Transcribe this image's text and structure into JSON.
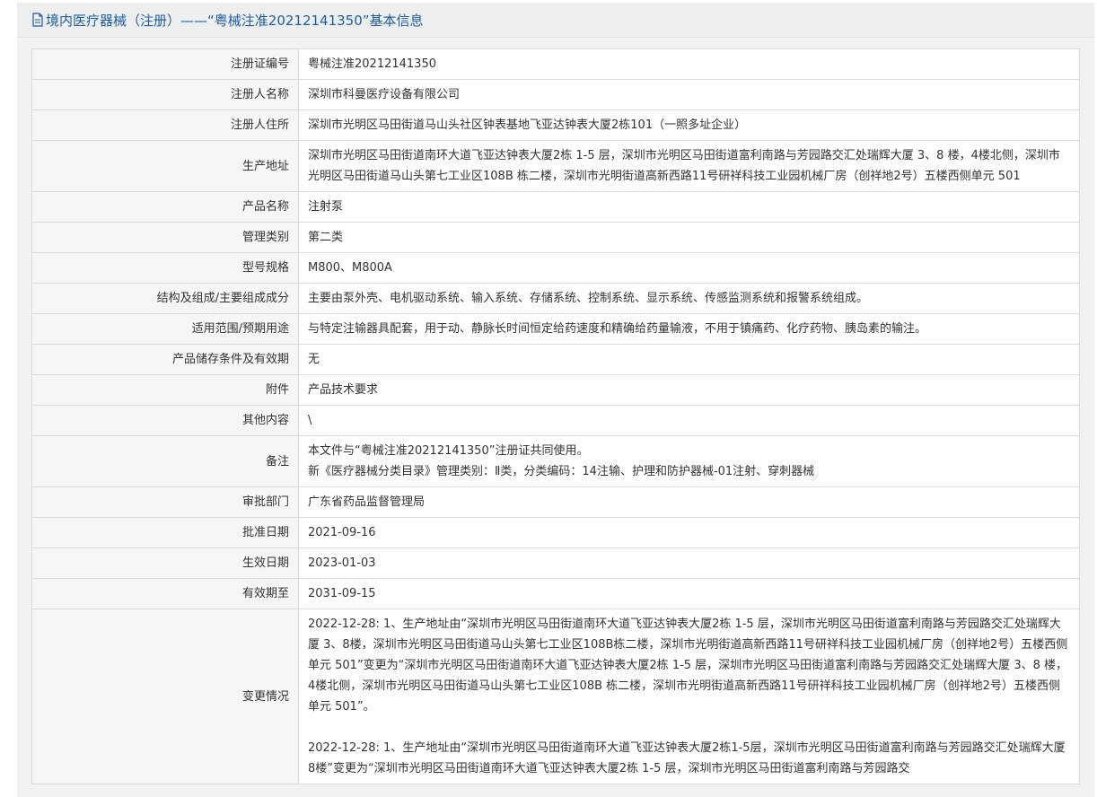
{
  "header": {
    "icon": "document-icon",
    "title": "境内医疗器械（注册）——“粤械注准20212141350”基本信息",
    "color": "#1a5fa6"
  },
  "rows": [
    {
      "label": "注册证编号",
      "value": "粤械注准20212141350"
    },
    {
      "label": "注册人名称",
      "value": "深圳市科曼医疗设备有限公司"
    },
    {
      "label": "注册人住所",
      "value": "深圳市光明区马田街道马山头社区钟表基地飞亚达钟表大厦2栋101（一照多址企业）"
    },
    {
      "label": "生产地址",
      "value": "深圳市光明区马田街道南环大道飞亚达钟表大厦2栋 1-5 层，深圳市光明区马田街道富利南路与芳园路交汇处瑞辉大厦 3、8 楼，4楼北侧，深圳市光明区马田街道马山头第七工业区108B 栋二楼，深圳市光明街道高新西路11号研祥科技工业园机械厂房（创祥地2号）五楼西侧单元 501"
    },
    {
      "label": "产品名称",
      "value": "注射泵"
    },
    {
      "label": "管理类别",
      "value": "第二类"
    },
    {
      "label": "型号规格",
      "value": "M800、M800A"
    },
    {
      "label": "结构及组成/主要组成成分",
      "value": "主要由泵外壳、电机驱动系统、输入系统、存储系统、控制系统、显示系统、传感监测系统和报警系统组成。"
    },
    {
      "label": "适用范围/预期用途",
      "value": "与特定注输器具配套，用于动、静脉长时间恒定给药速度和精确给药量输液，不用于镇痛药、化疗药物、胰岛素的输注。"
    },
    {
      "label": "产品储存条件及有效期",
      "value": "无"
    },
    {
      "label": "附件",
      "value": "产品技术要求"
    },
    {
      "label": "其他内容",
      "value": "\\"
    },
    {
      "label": "备注",
      "lines": [
        "本文件与“粤械注准20212141350”注册证共同使用。",
        "新《医疗器械分类目录》管理类别：Ⅱ类，分类编码：14注输、护理和防护器械-01注射、穿刺器械"
      ]
    },
    {
      "label": "审批部门",
      "value": "广东省药品监督管理局"
    },
    {
      "label": "批准日期",
      "value": "2021-09-16"
    },
    {
      "label": "生效日期",
      "value": "2023-01-03"
    },
    {
      "label": "有效期至",
      "value": "2031-09-15"
    }
  ],
  "changes": {
    "label": "变更情况",
    "entries": [
      "2022-12-28: 1、生产地址由“深圳市光明区马田街道南环大道飞亚达钟表大厦2栋 1-5 层，深圳市光明区马田街道富利南路与芳园路交汇处瑞辉大厦 3、8楼，深圳市光明区马田街道马山头第七工业区108B栋二楼，深圳市光明街道高新西路11号研祥科技工业园机械厂房（创祥地2号）五楼西侧单元 501”变更为“深圳市光明区马田街道南环大道飞亚达钟表大厦2栋 1-5 层，深圳市光明区马田街道富利南路与芳园路交汇处瑞辉大厦 3、8 楼，4楼北侧，深圳市光明区马田街道马山头第七工业区108B 栋二楼，深圳市光明街道高新西路11号研祥科技工业园机械厂房（创祥地2号）五楼西侧单元 501”。",
      "2022-12-28: 1、生产地址由“深圳市光明区马田街道南环大道飞亚达钟表大厦2栋1-5层，深圳市光明区马田街道富利南路与芳园路交汇处瑞辉大厦8楼”变更为“深圳市光明区马田街道南环大道飞亚达钟表大厦2栋 1-5 层，深圳市光明区马田街道富利南路与芳园路交"
    ]
  }
}
